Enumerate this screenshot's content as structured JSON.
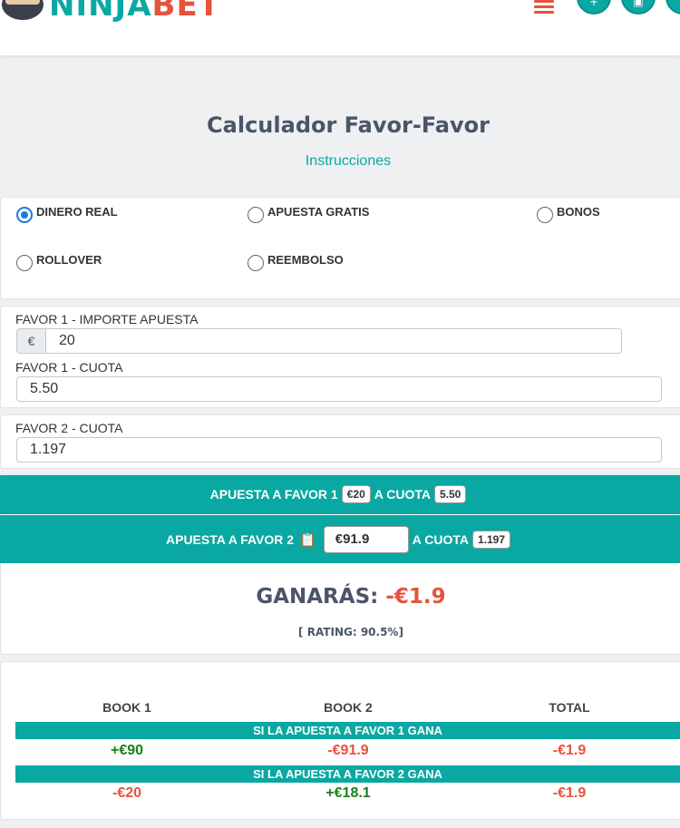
{
  "header": {
    "logo_text_a": "NINJA",
    "logo_text_b": "BET",
    "menu_icon": "hamburger-icon",
    "action_icons": [
      "plus-icon",
      "save-icon"
    ]
  },
  "page": {
    "title": "Calculador Favor-Favor",
    "instructions": "Instrucciones"
  },
  "bet_types": [
    {
      "label": "DINERO REAL",
      "checked": true
    },
    {
      "label": "APUESTA GRATIS",
      "checked": false
    },
    {
      "label": "BONOS",
      "checked": false
    },
    {
      "label": "ROLLOVER",
      "checked": false
    },
    {
      "label": "REEMBOLSO",
      "checked": false
    }
  ],
  "favor1": {
    "stake_label": "FAVOR 1 - IMPORTE APUESTA",
    "currency": "€",
    "stake_value": "20",
    "odds_label": "FAVOR 1 - CUOTA",
    "odds_value": "5.50"
  },
  "favor2": {
    "odds_label": "FAVOR 2 - CUOTA",
    "odds_value": "1.197"
  },
  "result": {
    "line1_prefix": "APUESTA A FAVOR 1",
    "line1_stake": "€20",
    "line1_mid": "A CUOTA",
    "line1_odds": "5.50",
    "line2_prefix": "APUESTA A FAVOR 2",
    "line2_stake": "€91.9",
    "line2_mid": "A CUOTA",
    "line2_odds": "1.197",
    "ganaras_label": "GANARÁS:",
    "ganaras_value": "-€1.9",
    "rating": "[ RATING: 90.5%]"
  },
  "table": {
    "headers": [
      "BOOK 1",
      "BOOK 2",
      "TOTAL"
    ],
    "scenario1": "SI LA APUESTA A FAVOR 1 GANA",
    "row1": [
      "+€90",
      "-€91.9",
      "-€1.9"
    ],
    "scenario2": "SI LA APUESTA A FAVOR 2 GANA",
    "row2": [
      "-€20",
      "+€18.1",
      "-€1.9"
    ]
  },
  "colors": {
    "accent": "#0aa8a3",
    "negative": "#e5533d",
    "positive": "#1a7f1a"
  }
}
